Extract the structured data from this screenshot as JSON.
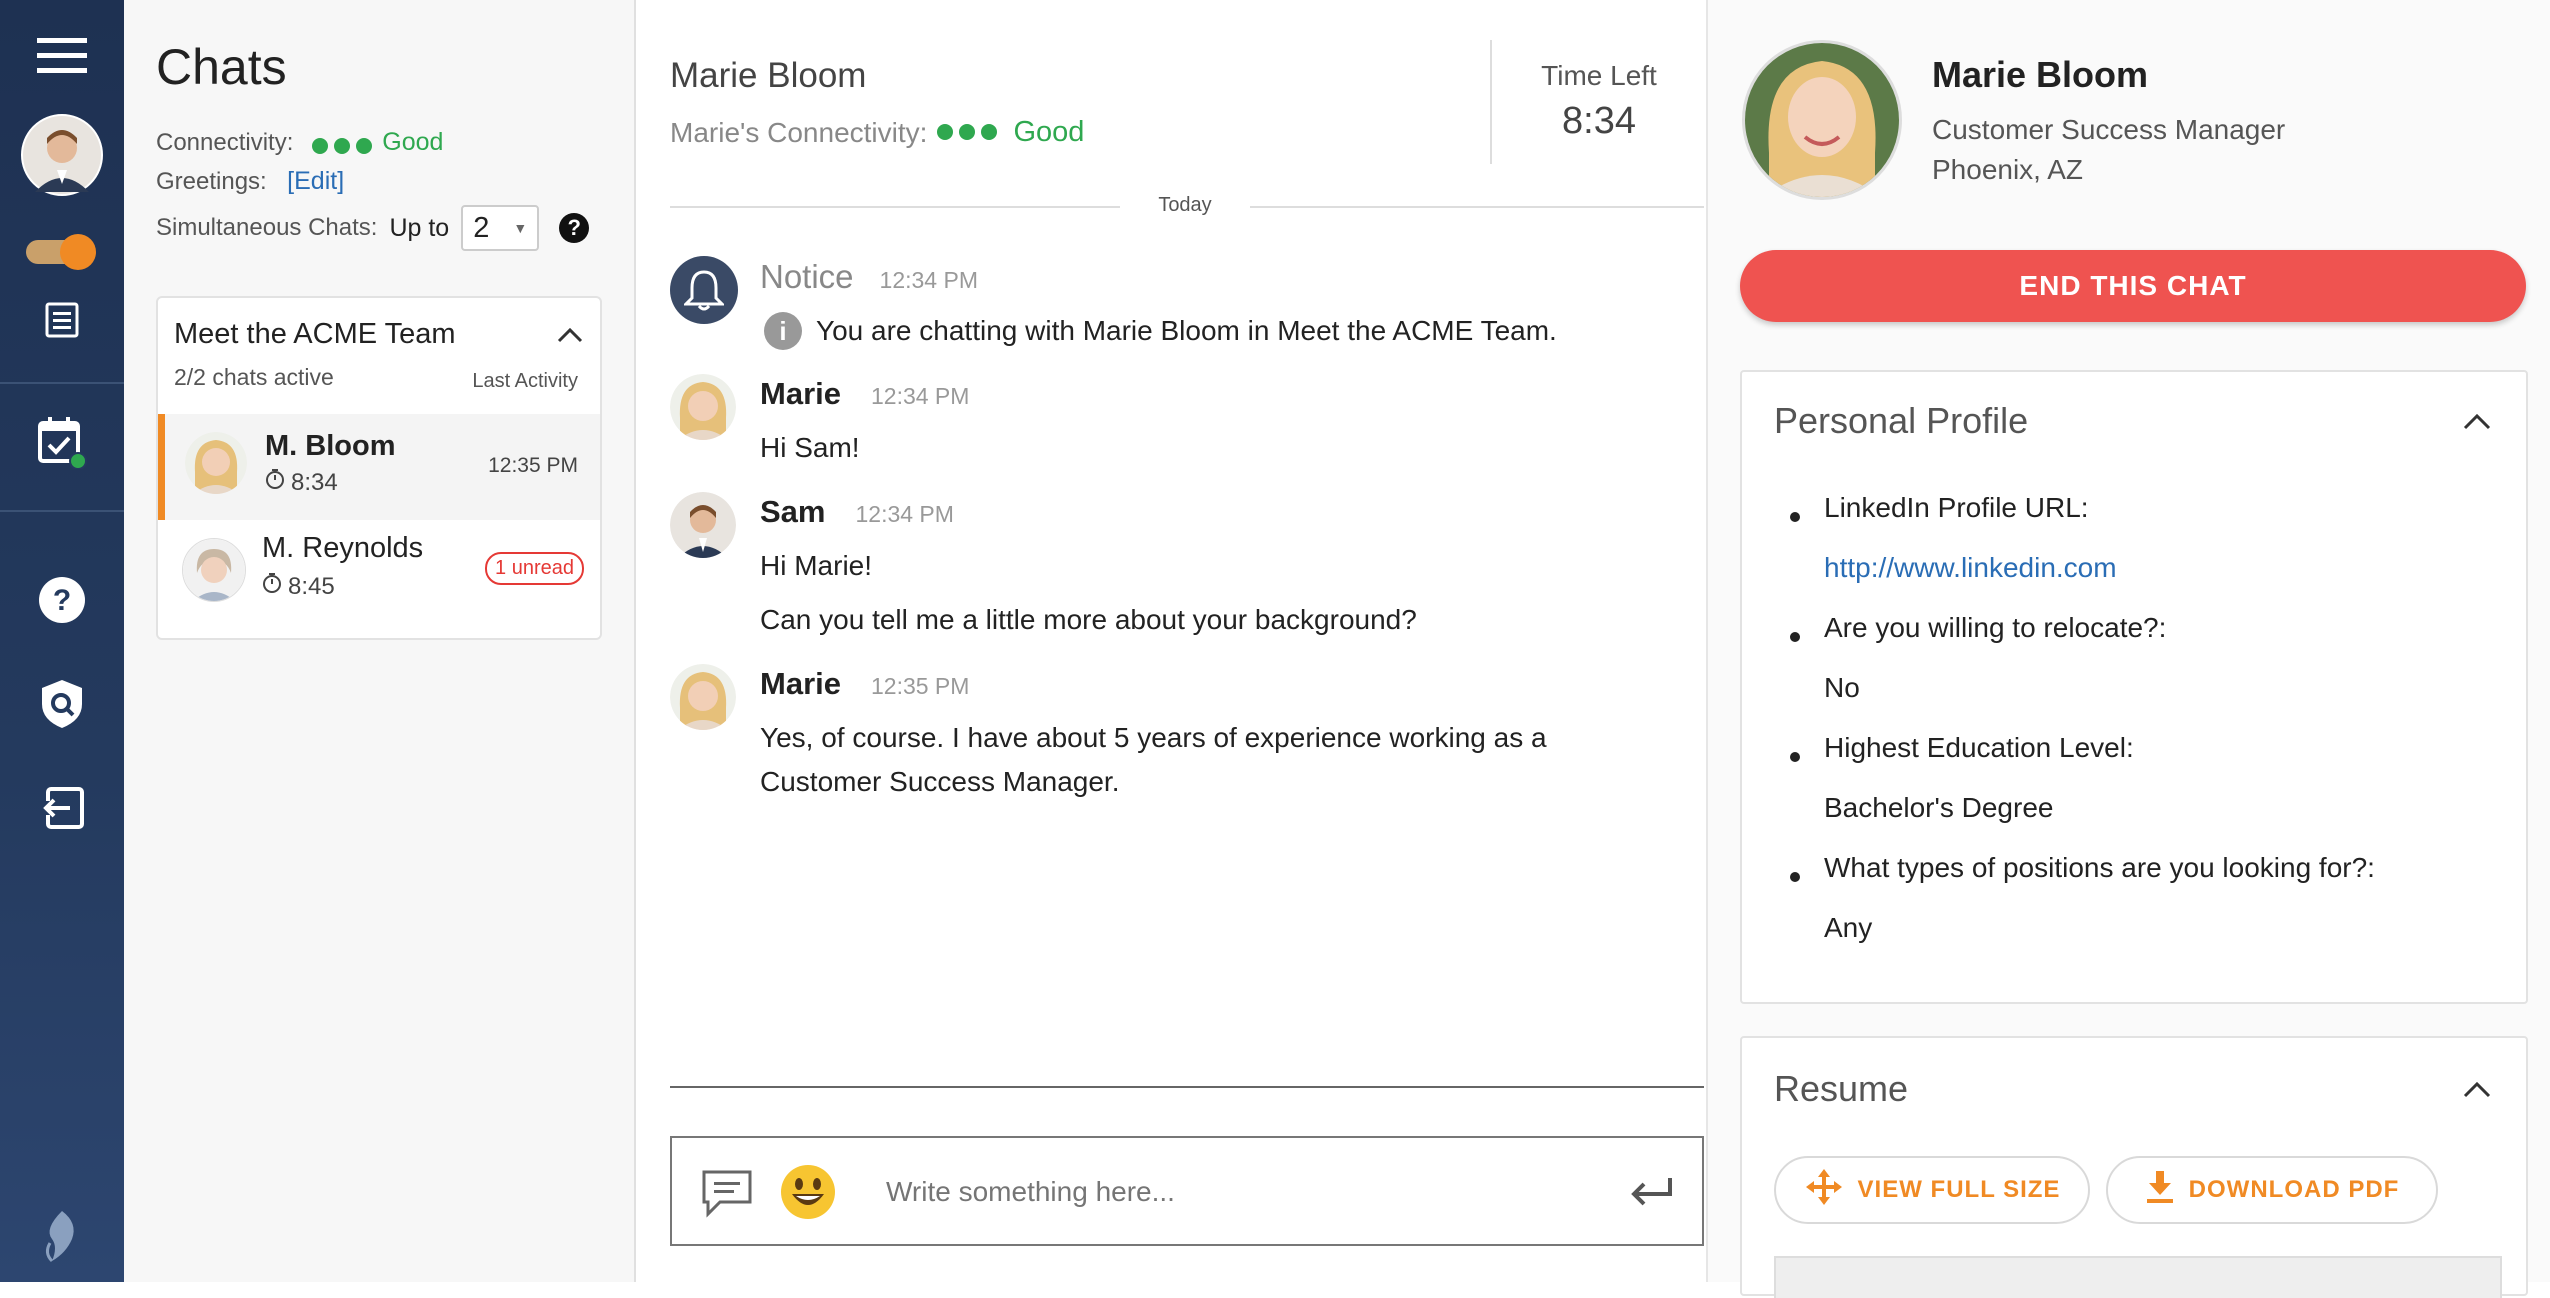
{
  "sidebar": {
    "icons": [
      "menu-icon",
      "avatar",
      "toggle",
      "list-icon",
      "calendar-check-icon",
      "help-icon",
      "shield-search-icon",
      "logout-icon",
      "logo-icon"
    ]
  },
  "chats_panel": {
    "title": "Chats",
    "connectivity_label": "Connectivity:",
    "connectivity_value": "Good",
    "greetings_label": "Greetings:",
    "greetings_edit": "[Edit]",
    "simultaneous_label": "Simultaneous Chats:",
    "up_to": "Up to",
    "simultaneous_value": "2",
    "help": "?",
    "group": {
      "name": "Meet the ACME Team",
      "active": "2/2 chats active",
      "last_activity": "Last Activity",
      "items": [
        {
          "name": "M. Bloom",
          "timer": "8:34",
          "time": "12:35 PM",
          "active": true
        },
        {
          "name": "M. Reynolds",
          "timer": "8:45",
          "badge": "1 unread",
          "active": false
        }
      ]
    }
  },
  "chat": {
    "contact_name": "Marie Bloom",
    "connectivity_label": "Marie's Connectivity:",
    "connectivity_value": "Good",
    "time_left_label": "Time Left",
    "time_left_value": "8:34",
    "day_divider": "Today",
    "notice": {
      "name": "Notice",
      "time": "12:34 PM",
      "text": "You are chatting with Marie Bloom in Meet the ACME Team."
    },
    "messages": [
      {
        "name": "Marie",
        "time": "12:34 PM",
        "lines": [
          "Hi Sam!"
        ]
      },
      {
        "name": "Sam",
        "time": "12:34 PM",
        "lines": [
          "Hi Marie!",
          "Can you tell me a little more about your background?"
        ]
      },
      {
        "name": "Marie",
        "time": "12:35 PM",
        "lines": [
          "Yes, of course. I have about 5 years of experience working as a",
          "Customer Success Manager."
        ]
      }
    ],
    "input_placeholder": "Write something here..."
  },
  "profile": {
    "name": "Marie Bloom",
    "title": "Customer Success Manager",
    "location": "Phoenix, AZ",
    "end_chat": "END THIS CHAT",
    "personal_profile_title": "Personal Profile",
    "fields": [
      {
        "q": "LinkedIn Profile URL:",
        "a": "http://www.linkedin.com"
      },
      {
        "q": "Are you willing to relocate?:",
        "a": "No"
      },
      {
        "q": "Highest Education Level:",
        "a": "Bachelor's Degree"
      },
      {
        "q": "What types of positions are you looking for?:",
        "a": "Any"
      }
    ],
    "resume_title": "Resume",
    "view_full_size": "VIEW FULL SIZE",
    "download_pdf": "DOWNLOAD PDF"
  },
  "colors": {
    "accent": "#f08a24",
    "end_chat": "#ef5350",
    "good": "#2fa84f",
    "rail": "#243a5e",
    "link": "#2a6db5"
  }
}
